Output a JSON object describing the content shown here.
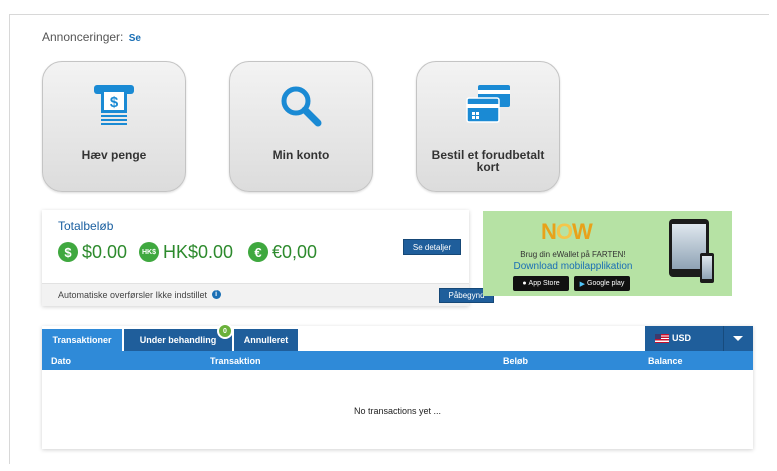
{
  "announcements": {
    "label": "Annonceringer:",
    "link": "Se"
  },
  "tiles": [
    {
      "label": "Hæv penge",
      "icon": "atm-withdraw-icon"
    },
    {
      "label": "Min konto",
      "icon": "magnifier-icon"
    },
    {
      "label": "Bestil et forudbetalt kort",
      "icon": "cards-icon"
    }
  ],
  "totals": {
    "title": "Totalbeløb",
    "balances": [
      {
        "symbol": "$",
        "amount": "$0.00"
      },
      {
        "symbol": "HK$",
        "amount": "HK$0.00"
      },
      {
        "symbol": "€",
        "amount": "€0,00"
      }
    ],
    "details_button": "Se detaljer",
    "auto_transfer_text": "Automatiske overførsler Ikke indstillet",
    "start_button": "Påbegynd"
  },
  "promo": {
    "brand_n": "N",
    "brand_o": "O",
    "brand_w": "W",
    "line1": "Brug din eWallet på FARTEN!",
    "line2": "Download mobilapplikation",
    "app_store": "App Store",
    "google_play": "Google play"
  },
  "transactions": {
    "tabs": [
      {
        "label": "Transaktioner",
        "active": true
      },
      {
        "label": "Under behandling",
        "badge": "0"
      },
      {
        "label": "Annulleret"
      }
    ],
    "currency": "USD",
    "columns": [
      "Dato",
      "Transaktion",
      "Beløb",
      "Balance"
    ],
    "empty_message": "No transactions yet ..."
  },
  "colors": {
    "primary": "#1f5e9b",
    "accent": "#2f8ad8",
    "success": "#3fa83f",
    "promo_bg": "#b6e2a4"
  }
}
